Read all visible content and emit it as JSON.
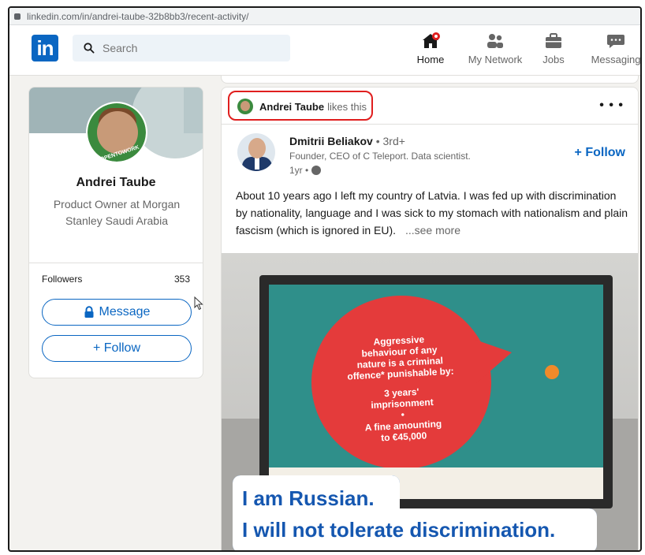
{
  "browser": {
    "url": "linkedin.com/in/andrei-taube-32b8bb3/recent-activity/"
  },
  "nav": {
    "logo": "in",
    "search_placeholder": "Search",
    "home": "Home",
    "network": "My Network",
    "jobs": "Jobs",
    "messaging": "Messaging"
  },
  "profile": {
    "avatar_text": "#OPENTOWORK",
    "name": "Andrei Taube",
    "title": "Product Owner at Morgan Stanley Saudi Arabia",
    "followers_label": "Followers",
    "followers_count": "353",
    "message_label": "Message",
    "follow_label": "+ Follow"
  },
  "post": {
    "liker": "Andrei Taube",
    "liker_action": "likes this",
    "more": "• • •",
    "author_name": "Dmitrii Beliakov",
    "author_degree": "• 3rd+",
    "author_headline": "Founder, CEO of C Teleport. Data scientist.",
    "author_time": "1yr •",
    "follow_label": "+ Follow",
    "text": "About 10 years ago I left my country of Latvia. I was fed up with discrimination by nationality, language and I was sick to my stomach with nationalism and plain fascism (which is ignored in EU).",
    "see_more": "...see more",
    "image": {
      "sign_lines": [
        "Aggressive",
        "behaviour of any",
        "nature is a criminal",
        "offence* punishable by:",
        "3 years'",
        "imprisonment",
        "•",
        "A fine amounting",
        "to €45,000"
      ],
      "caption_line1": "I am Russian.",
      "caption_line2": "I will not tolerate discrimination."
    }
  },
  "colors": {
    "linkedin_blue": "#0a66c2",
    "highlight_red": "#e01e1e",
    "caption_blue": "#1557b0"
  }
}
